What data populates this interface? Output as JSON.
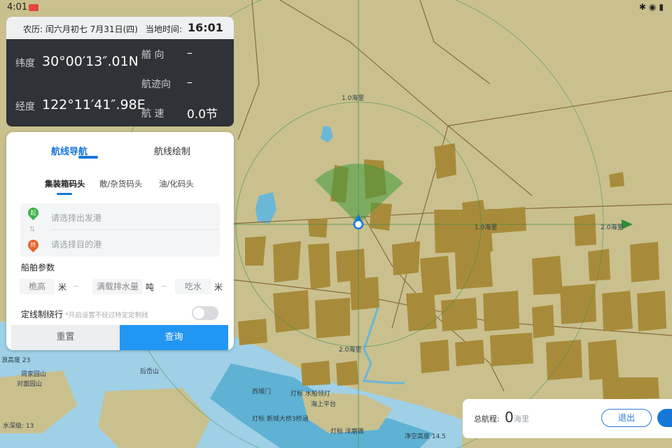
{
  "status_bar": {
    "time": "4:01"
  },
  "info_panel": {
    "lunar_date": "农历: 闰六月初七  7月31日(四)",
    "local_time_label": "当地时间:",
    "local_time": "16:01",
    "lat_label": "纬度",
    "lat_value": "30°00′13″.01N",
    "lon_label": "经度",
    "lon_value": "122°11′41″.98E",
    "heading_label": "艏  向",
    "heading_value": "–",
    "track_label": "航迹向",
    "track_value": "–",
    "speed_label": "航  速",
    "speed_value": "0.0节"
  },
  "route_panel": {
    "tabs": [
      "航线导航",
      "航线绘制"
    ],
    "sub_tabs": [
      "集装箱码头",
      "散/杂货码头",
      "油/化码头"
    ],
    "origin_placeholder": "请选择出发港",
    "dest_placeholder": "请选择目的港",
    "origin_pin": "起",
    "dest_pin": "终",
    "ship_params_title": "船舶参数",
    "params": [
      {
        "placeholder": "桅高",
        "unit": "米"
      },
      {
        "placeholder": "满载排水量",
        "unit": "吨"
      },
      {
        "placeholder": "吃水",
        "unit": "米"
      }
    ],
    "toggle_label": "定线制绕行",
    "toggle_hint": "*开启设置不经过特定定制线",
    "toggle_on": false,
    "reset_label": "重置",
    "query_label": "查询"
  },
  "bottom_panel": {
    "total_label": "总航程:",
    "total_value": "0",
    "total_unit": "海里",
    "exit_label": "退出"
  },
  "map": {
    "labels": [
      "1.0海里",
      "2.0海里",
      "1.0海里",
      "2.0海里",
      "西堠门",
      "灯标 水船领灯",
      "海上平台",
      "灯标 新城大桥3桥涵",
      "净空高度 14.5",
      "灯标 洋磨礁",
      "后岙山",
      "周家园山",
      "对面园山",
      "浪高度 23",
      "水深级: 13"
    ]
  },
  "colors": {
    "land": "#c9c08e",
    "building": "#a88b3a",
    "water": "#9fd0e6",
    "water_deep": "#6ab7d6",
    "accent": "#1677d8",
    "heading_green": "#3e9a3a"
  }
}
